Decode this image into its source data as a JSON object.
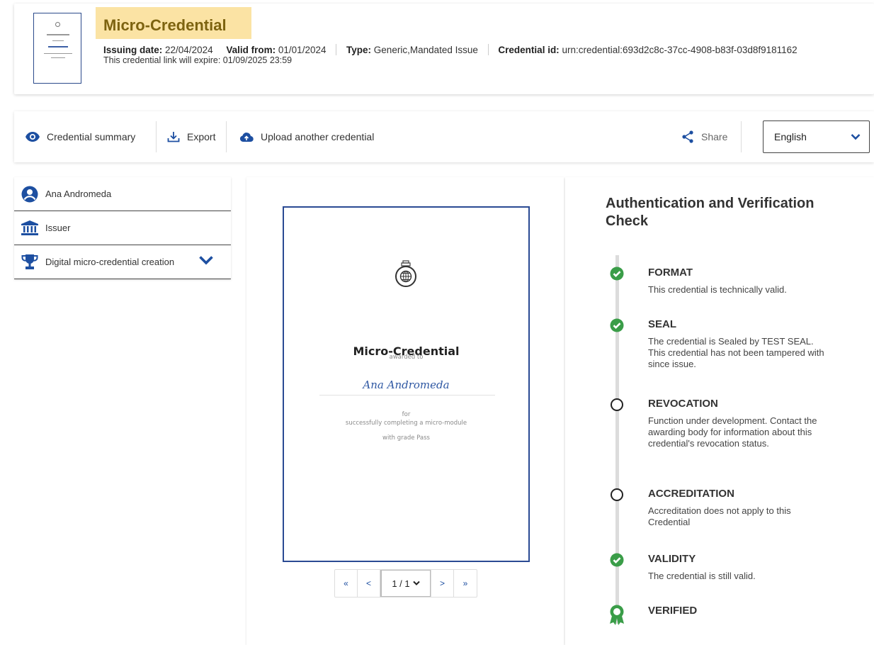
{
  "header": {
    "title": "Micro-Credential",
    "issuing_label": "Issuing date:",
    "issuing_value": "22/04/2024",
    "valid_label": "Valid from:",
    "valid_value": "01/01/2024",
    "type_label": "Type:",
    "type_value": "Generic,Mandated Issue",
    "id_label": "Credential id:",
    "id_value": "urn:credential:693d2c8c-37cc-4908-b83f-03d8f9181162",
    "expire_text": "This credential link will expire: 01/09/2025 23:59"
  },
  "toolbar": {
    "summary_label": "Credential summary",
    "export_label": "Export",
    "upload_label": "Upload another credential",
    "share_label": "Share",
    "language_value": "English"
  },
  "sidebar": {
    "items": [
      {
        "label": "Ana Andromeda",
        "icon": "user-circle-icon"
      },
      {
        "label": "Issuer",
        "icon": "institution-icon"
      },
      {
        "label": "Digital micro-credential creation",
        "icon": "trophy-icon"
      }
    ]
  },
  "document": {
    "title": "Micro-Credential",
    "awarded_to": "awarded to",
    "recipient": "Ana Andromeda",
    "for_text": "for",
    "reason": "successfully completing a micro-module",
    "grade": "with grade Pass"
  },
  "pager": {
    "first": "«",
    "prev": "<",
    "page_select": "1 / 1",
    "next": ">",
    "last": "»"
  },
  "verification": {
    "title": "Authentication and Verification Check",
    "checks": [
      {
        "title": "FORMAT",
        "desc": "This credential is technically valid.",
        "status": "ok"
      },
      {
        "title": "SEAL",
        "desc": "The credential is Sealed by TEST SEAL. This credential has not been tampered with since issue.",
        "status": "ok"
      },
      {
        "title": "REVOCATION",
        "desc": "Function under development. Contact the awarding body for information about this credential's revocation status.",
        "status": "pending"
      },
      {
        "title": "ACCREDITATION",
        "desc": "Accreditation does not apply to this Credential",
        "status": "pending"
      },
      {
        "title": "VALIDITY",
        "desc": "The credential is still valid.",
        "status": "ok"
      },
      {
        "title": "VERIFIED",
        "desc": "",
        "status": "verified"
      }
    ]
  },
  "colors": {
    "brand_blue": "#1d4fa1",
    "check_green": "#3a9d48",
    "title_highlight": "#fbe3a4"
  }
}
